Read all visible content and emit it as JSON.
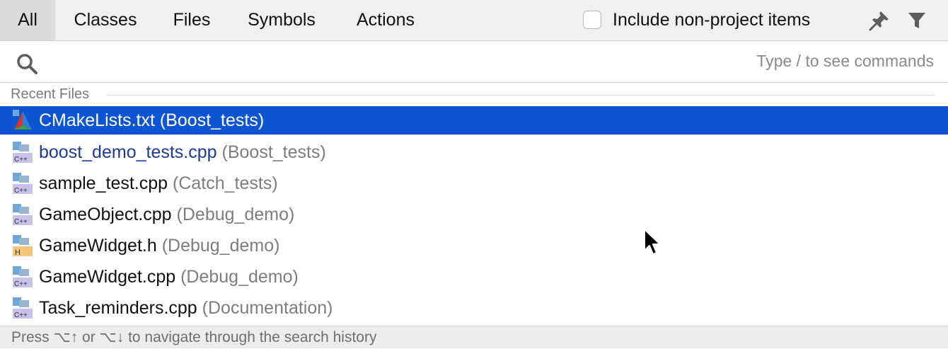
{
  "tabs": [
    {
      "label": "All",
      "active": true
    },
    {
      "label": "Classes",
      "active": false
    },
    {
      "label": "Files",
      "active": false
    },
    {
      "label": "Symbols",
      "active": false
    },
    {
      "label": "Actions",
      "active": false
    }
  ],
  "include_non_project": {
    "label": "Include non-project items",
    "checked": false
  },
  "search": {
    "value": "",
    "hint": "Type / to see commands"
  },
  "section": {
    "title": "Recent Files"
  },
  "files": [
    {
      "name": "CMakeLists.txt",
      "project": "(Boost_tests)",
      "icon": "cmake-icon",
      "selected": true
    },
    {
      "name": "boost_demo_tests.cpp",
      "project": "(Boost_tests)",
      "icon": "cpp-file-icon"
    },
    {
      "name": "sample_test.cpp",
      "project": "(Catch_tests)",
      "icon": "cpp-file-icon"
    },
    {
      "name": "GameObject.cpp",
      "project": "(Debug_demo)",
      "icon": "cpp-file-icon"
    },
    {
      "name": "GameWidget.h",
      "project": "(Debug_demo)",
      "icon": "header-file-icon"
    },
    {
      "name": "GameWidget.cpp",
      "project": "(Debug_demo)",
      "icon": "cpp-file-icon"
    },
    {
      "name": "Task_reminders.cpp",
      "project": "(Documentation)",
      "icon": "cpp-file-icon"
    }
  ],
  "footer": {
    "text": "Press ⌥↑ or ⌥↓ to navigate through the search history"
  },
  "colors": {
    "selection": "#0d55d2",
    "link_text": "#1c3a9c",
    "cpp_badge": "#c8c2ea",
    "header_badge": "#f3c67a"
  }
}
